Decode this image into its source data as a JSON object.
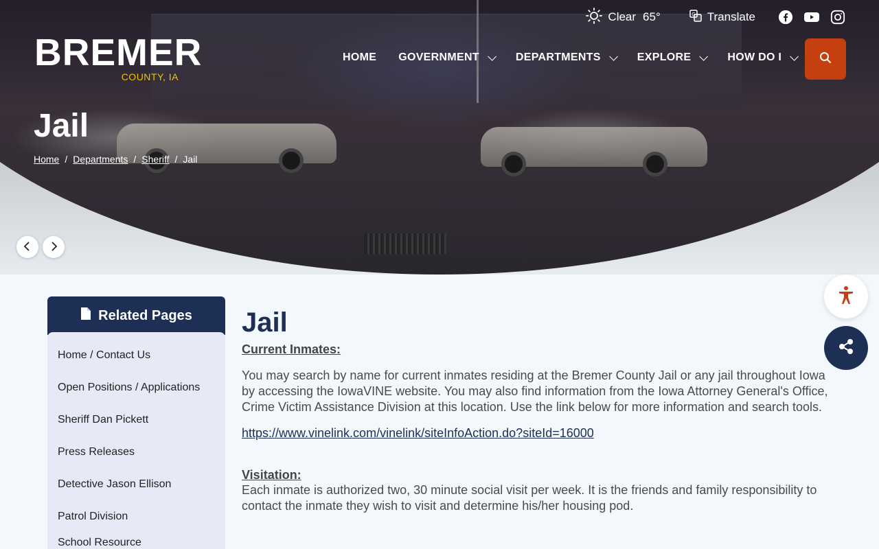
{
  "topbar": {
    "weather_condition": "Clear",
    "weather_temp": "65°",
    "translate_label": "Translate"
  },
  "logo": {
    "main": "BREMER",
    "sub": "COUNTY, IA"
  },
  "nav": {
    "items": [
      {
        "label": "HOME"
      },
      {
        "label": "GOVERNMENT"
      },
      {
        "label": "DEPARTMENTS"
      },
      {
        "label": "EXPLORE"
      },
      {
        "label": "HOW DO I"
      }
    ]
  },
  "hero": {
    "title": "Jail",
    "breadcrumbs": [
      "Home",
      "Departments",
      "Sheriff",
      "Jail"
    ]
  },
  "sidebar": {
    "title": "Related Pages",
    "items": [
      "Home / Contact Us",
      "Open Positions / Applications",
      "Sheriff Dan Pickett",
      "Press Releases",
      "Detective Jason Ellison",
      "Patrol Division",
      "School Resource Office/D.A.R.E"
    ]
  },
  "content": {
    "title": "Jail",
    "current_inmates_heading": "Current Inmates",
    "current_inmates_colon": ":",
    "current_inmates_text": "You may search by name for current inmates residing at the Bremer County Jail or any jail throughout Iowa by accessing the IowaVINE website. You may also find information from the Iowa Attorney General's Office, Crime Victim Assistance Division at this location. Use the link below for more information and search tools.",
    "vine_link": "https://www.vinelink.com/vinelink/siteInfoAction.do?siteId=16000",
    "visitation_heading": "Visitation:",
    "visitation_text": "Each inmate is authorized two, 30 minute social visit per week. It is the friends and family responsibility to contact the inmate they wish to visit and determine his/her housing pod."
  },
  "colors": {
    "navy": "#1e2f55",
    "search_orange": "#c63f10",
    "logo_gold": "#f2c300",
    "a11y_orange": "#c63f10"
  }
}
